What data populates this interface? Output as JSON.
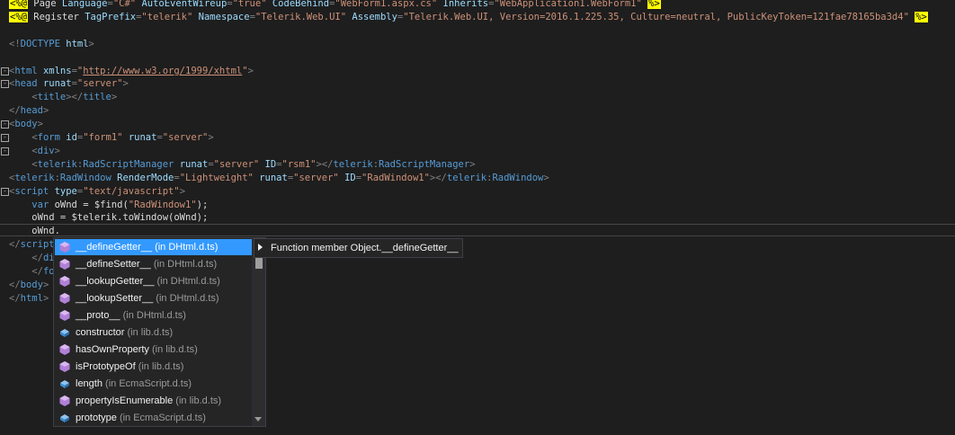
{
  "editor": {
    "lines": [
      {
        "directive_open": "<%@",
        "parts": [
          [
            "text",
            " Page "
          ],
          [
            "attr",
            "Language"
          ],
          [
            "punc",
            "="
          ],
          [
            "str",
            "\"C#\""
          ],
          [
            "text",
            " "
          ],
          [
            "attr",
            "AutoEventWireup"
          ],
          [
            "punc",
            "="
          ],
          [
            "str",
            "\"true\""
          ],
          [
            "text",
            " "
          ],
          [
            "attr",
            "CodeBehind"
          ],
          [
            "punc",
            "="
          ],
          [
            "str",
            "\"WebForm1.aspx.cs\""
          ],
          [
            "text",
            " "
          ],
          [
            "attr",
            "Inherits"
          ],
          [
            "punc",
            "="
          ],
          [
            "str",
            "\"WebApplication1.WebForm1\""
          ],
          [
            "text",
            " "
          ]
        ],
        "directive_close": "%>"
      },
      {
        "directive_open": "<%@",
        "parts": [
          [
            "text",
            " Register "
          ],
          [
            "attr",
            "TagPrefix"
          ],
          [
            "punc",
            "="
          ],
          [
            "str",
            "\"telerik\""
          ],
          [
            "text",
            " "
          ],
          [
            "attr",
            "Namespace"
          ],
          [
            "punc",
            "="
          ],
          [
            "str",
            "\"Telerik.Web.UI\""
          ],
          [
            "text",
            " "
          ],
          [
            "attr",
            "Assembly"
          ],
          [
            "punc",
            "="
          ],
          [
            "str",
            "\"Telerik.Web.UI, Version=2016.1.225.35, Culture=neutral, PublicKeyToken=121fae78165ba3d4\""
          ],
          [
            "text",
            " "
          ]
        ],
        "directive_close": "%>"
      },
      {
        "parts": []
      },
      {
        "parts": [
          [
            "punc",
            "<!"
          ],
          [
            "tag",
            "DOCTYPE"
          ],
          [
            "text",
            " "
          ],
          [
            "attr",
            "html"
          ],
          [
            "punc",
            ">"
          ]
        ]
      },
      {
        "parts": []
      },
      {
        "fold": "-",
        "parts": [
          [
            "punc",
            "<"
          ],
          [
            "tag",
            "html"
          ],
          [
            "text",
            " "
          ],
          [
            "attr",
            "xmlns"
          ],
          [
            "punc",
            "="
          ],
          [
            "str",
            "\""
          ],
          [
            "url",
            "http://www.w3.org/1999/xhtml"
          ],
          [
            "str",
            "\""
          ],
          [
            "punc",
            ">"
          ]
        ]
      },
      {
        "fold": "-",
        "parts": [
          [
            "punc",
            "<"
          ],
          [
            "tag",
            "head"
          ],
          [
            "text",
            " "
          ],
          [
            "attr",
            "runat"
          ],
          [
            "punc",
            "="
          ],
          [
            "str",
            "\"server\""
          ],
          [
            "punc",
            ">"
          ]
        ]
      },
      {
        "parts": [
          [
            "text",
            "    "
          ],
          [
            "punc",
            "<"
          ],
          [
            "tag",
            "title"
          ],
          [
            "punc",
            "></"
          ],
          [
            "tag",
            "title"
          ],
          [
            "punc",
            ">"
          ]
        ]
      },
      {
        "parts": [
          [
            "punc",
            "</"
          ],
          [
            "tag",
            "head"
          ],
          [
            "punc",
            ">"
          ]
        ]
      },
      {
        "fold": "-",
        "parts": [
          [
            "punc",
            "<"
          ],
          [
            "tag",
            "body"
          ],
          [
            "punc",
            ">"
          ]
        ]
      },
      {
        "fold": "-",
        "parts": [
          [
            "text",
            "    "
          ],
          [
            "punc",
            "<"
          ],
          [
            "tag",
            "form"
          ],
          [
            "text",
            " "
          ],
          [
            "attr",
            "id"
          ],
          [
            "punc",
            "="
          ],
          [
            "str",
            "\"form1\""
          ],
          [
            "text",
            " "
          ],
          [
            "attr",
            "runat"
          ],
          [
            "punc",
            "="
          ],
          [
            "str",
            "\"server\""
          ],
          [
            "punc",
            ">"
          ]
        ]
      },
      {
        "fold": "-",
        "parts": [
          [
            "text",
            "    "
          ],
          [
            "punc",
            "<"
          ],
          [
            "tag",
            "div"
          ],
          [
            "punc",
            ">"
          ]
        ]
      },
      {
        "parts": [
          [
            "text",
            "    "
          ],
          [
            "punc",
            "<"
          ],
          [
            "tag",
            "telerik"
          ],
          [
            "punc",
            ":"
          ],
          [
            "tag",
            "RadScriptManager"
          ],
          [
            "text",
            " "
          ],
          [
            "attr",
            "runat"
          ],
          [
            "punc",
            "="
          ],
          [
            "str",
            "\"server\""
          ],
          [
            "text",
            " "
          ],
          [
            "attr",
            "ID"
          ],
          [
            "punc",
            "="
          ],
          [
            "str",
            "\"rsm1\""
          ],
          [
            "punc",
            "></"
          ],
          [
            "tag",
            "telerik"
          ],
          [
            "punc",
            ":"
          ],
          [
            "tag",
            "RadScriptManager"
          ],
          [
            "punc",
            ">"
          ]
        ]
      },
      {
        "parts": [
          [
            "punc",
            "<"
          ],
          [
            "tag",
            "telerik"
          ],
          [
            "punc",
            ":"
          ],
          [
            "tag",
            "RadWindow"
          ],
          [
            "text",
            " "
          ],
          [
            "attr",
            "RenderMode"
          ],
          [
            "punc",
            "="
          ],
          [
            "str",
            "\"Lightweight\""
          ],
          [
            "text",
            " "
          ],
          [
            "attr",
            "runat"
          ],
          [
            "punc",
            "="
          ],
          [
            "str",
            "\"server\""
          ],
          [
            "text",
            " "
          ],
          [
            "attr",
            "ID"
          ],
          [
            "punc",
            "="
          ],
          [
            "str",
            "\"RadWindow1\""
          ],
          [
            "punc",
            "></"
          ],
          [
            "tag",
            "telerik"
          ],
          [
            "punc",
            ":"
          ],
          [
            "tag",
            "RadWindow"
          ],
          [
            "punc",
            ">"
          ]
        ]
      },
      {
        "fold": "-",
        "parts": [
          [
            "punc",
            "<"
          ],
          [
            "tag",
            "script"
          ],
          [
            "text",
            " "
          ],
          [
            "attr",
            "type"
          ],
          [
            "punc",
            "="
          ],
          [
            "str",
            "\"text/javascript\""
          ],
          [
            "punc",
            ">"
          ]
        ]
      },
      {
        "parts": [
          [
            "text",
            "    "
          ],
          [
            "kw",
            "var"
          ],
          [
            "text",
            " oWnd = "
          ],
          [
            "fn",
            "$find"
          ],
          [
            "text",
            "("
          ],
          [
            "str",
            "\"RadWindow1\""
          ],
          [
            "text",
            ");"
          ]
        ]
      },
      {
        "parts": [
          [
            "text",
            "    oWnd = "
          ],
          [
            "fn",
            "$telerik"
          ],
          [
            "text",
            "."
          ],
          [
            "fn",
            "toWindow"
          ],
          [
            "text",
            "(oWnd);"
          ]
        ]
      },
      {
        "parts": [
          [
            "text",
            "    oWnd."
          ]
        ]
      },
      {
        "parts": [
          [
            "punc",
            "</"
          ],
          [
            "tag",
            "script"
          ]
        ]
      },
      {
        "parts": [
          [
            "text",
            "    "
          ],
          [
            "punc",
            "</"
          ],
          [
            "tag",
            "di"
          ]
        ]
      },
      {
        "parts": [
          [
            "text",
            "    "
          ],
          [
            "punc",
            "</"
          ],
          [
            "tag",
            "fo"
          ]
        ]
      },
      {
        "parts": [
          [
            "punc",
            "</"
          ],
          [
            "tag",
            "body"
          ],
          [
            "punc",
            ">"
          ]
        ]
      },
      {
        "parts": [
          [
            "punc",
            "</"
          ],
          [
            "tag",
            "html"
          ],
          [
            "punc",
            ">"
          ]
        ]
      }
    ]
  },
  "completion": {
    "items": [
      {
        "name": "__defineGetter__",
        "source": "(in DHtml.d.ts)",
        "icon": "method-icon",
        "selected": true
      },
      {
        "name": "__defineSetter__",
        "source": "(in DHtml.d.ts)",
        "icon": "method-icon"
      },
      {
        "name": "__lookupGetter__",
        "source": "(in DHtml.d.ts)",
        "icon": "method-icon"
      },
      {
        "name": "__lookupSetter__",
        "source": "(in DHtml.d.ts)",
        "icon": "method-icon"
      },
      {
        "name": "__proto__",
        "source": "(in DHtml.d.ts)",
        "icon": "method-icon"
      },
      {
        "name": "constructor",
        "source": "(in lib.d.ts)",
        "icon": "property-icon"
      },
      {
        "name": "hasOwnProperty",
        "source": "(in lib.d.ts)",
        "icon": "method-icon"
      },
      {
        "name": "isPrototypeOf",
        "source": "(in lib.d.ts)",
        "icon": "method-icon"
      },
      {
        "name": "length",
        "source": "(in EcmaScript.d.ts)",
        "icon": "property-icon"
      },
      {
        "name": "propertyIsEnumerable",
        "source": "(in lib.d.ts)",
        "icon": "method-icon"
      },
      {
        "name": "prototype",
        "source": "(in EcmaScript.d.ts)",
        "icon": "property-icon"
      }
    ],
    "tooltip": "Function member Object.__defineGetter__"
  },
  "colors": {
    "method_icon": "#b180d7",
    "property_icon": "#3d8fd1",
    "selection": "#3399ff"
  }
}
